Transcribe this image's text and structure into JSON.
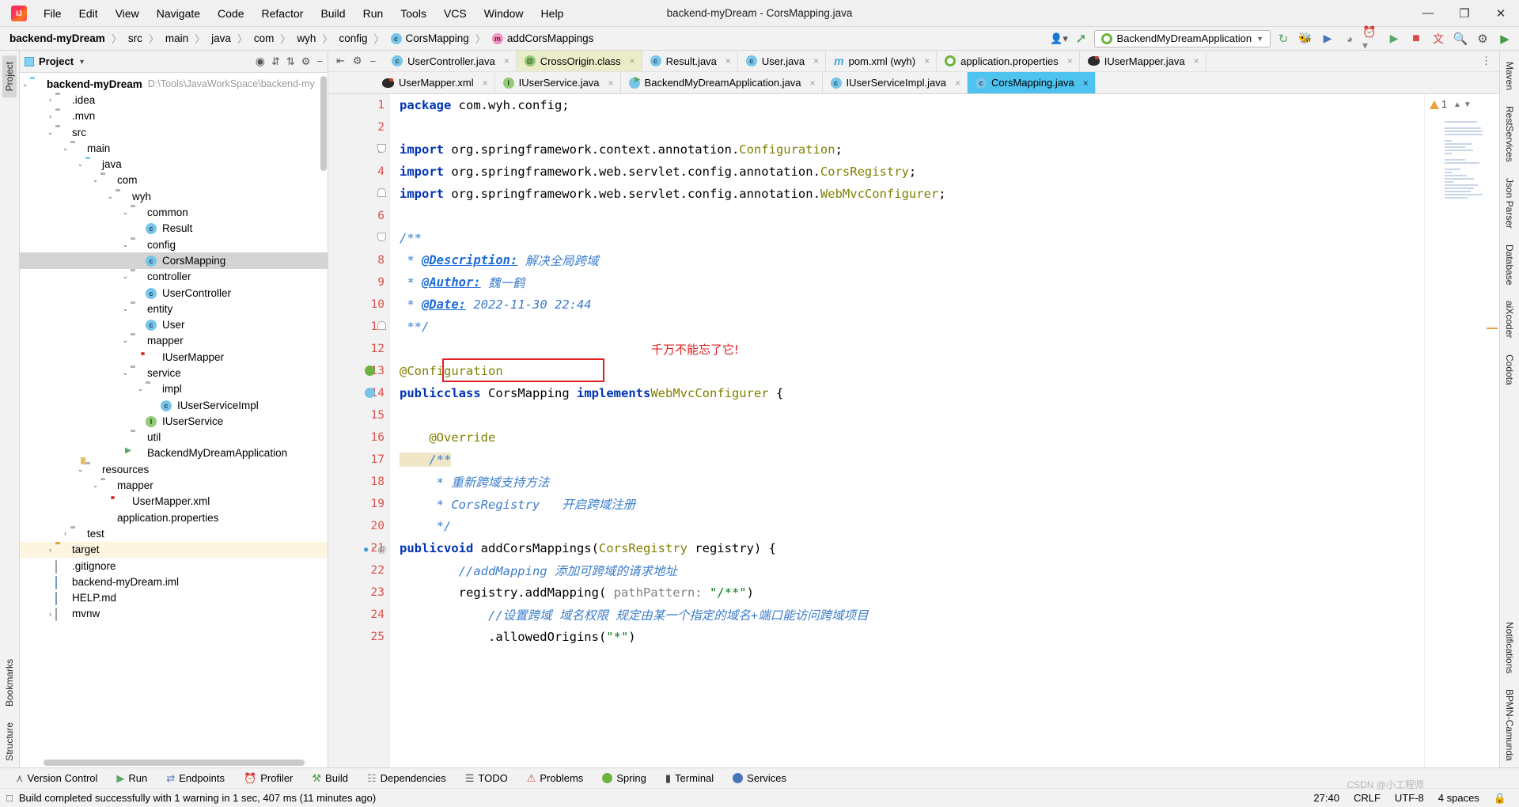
{
  "window": {
    "title": "backend-myDream - CorsMapping.java",
    "minimize": "—",
    "maximize": "❐",
    "close": "✕"
  },
  "menu": [
    "File",
    "Edit",
    "View",
    "Navigate",
    "Code",
    "Refactor",
    "Build",
    "Run",
    "Tools",
    "VCS",
    "Window",
    "Help"
  ],
  "breadcrumb": {
    "items": [
      "backend-myDream",
      "src",
      "main",
      "java",
      "com",
      "wyh",
      "config",
      "CorsMapping",
      "addCorsMappings"
    ],
    "separator": "〉"
  },
  "toolbar": {
    "run_config": "BackendMyDreamApplication",
    "chevron": "▼"
  },
  "project_panel": {
    "title": "Project",
    "dropdown": "▼",
    "root_label": "backend-myDream",
    "root_path": "D:\\Tools\\JavaWorkSpace\\backend-my",
    "tree": [
      {
        "label": ".idea",
        "depth": 1,
        "arrow": "›",
        "icon": "folder-gray"
      },
      {
        "label": ".mvn",
        "depth": 1,
        "arrow": "›",
        "icon": "folder-gray"
      },
      {
        "label": "src",
        "depth": 1,
        "arrow": "⌄",
        "icon": "folder-gray"
      },
      {
        "label": "main",
        "depth": 2,
        "arrow": "⌄",
        "icon": "folder-gray"
      },
      {
        "label": "java",
        "depth": 3,
        "arrow": "⌄",
        "icon": "folder-blue"
      },
      {
        "label": "com",
        "depth": 4,
        "arrow": "⌄",
        "icon": "folder-pkg"
      },
      {
        "label": "wyh",
        "depth": 5,
        "arrow": "⌄",
        "icon": "folder-pkg"
      },
      {
        "label": "common",
        "depth": 6,
        "arrow": "⌄",
        "icon": "folder-pkg"
      },
      {
        "label": "Result",
        "depth": 7,
        "arrow": "",
        "icon": "class"
      },
      {
        "label": "config",
        "depth": 6,
        "arrow": "⌄",
        "icon": "folder-pkg"
      },
      {
        "label": "CorsMapping",
        "depth": 7,
        "arrow": "",
        "icon": "class",
        "selected": true
      },
      {
        "label": "controller",
        "depth": 6,
        "arrow": "⌄",
        "icon": "folder-pkg"
      },
      {
        "label": "UserController",
        "depth": 7,
        "arrow": "",
        "icon": "class"
      },
      {
        "label": "entity",
        "depth": 6,
        "arrow": "⌄",
        "icon": "folder-pkg"
      },
      {
        "label": "User",
        "depth": 7,
        "arrow": "",
        "icon": "class"
      },
      {
        "label": "mapper",
        "depth": 6,
        "arrow": "⌄",
        "icon": "folder-pkg"
      },
      {
        "label": "IUserMapper",
        "depth": 7,
        "arrow": "",
        "icon": "mybatis"
      },
      {
        "label": "service",
        "depth": 6,
        "arrow": "⌄",
        "icon": "folder-pkg"
      },
      {
        "label": "impl",
        "depth": 7,
        "arrow": "⌄",
        "icon": "folder-pkg"
      },
      {
        "label": "IUserServiceImpl",
        "depth": 8,
        "arrow": "",
        "icon": "class"
      },
      {
        "label": "IUserService",
        "depth": 7,
        "arrow": "",
        "icon": "interface"
      },
      {
        "label": "util",
        "depth": 6,
        "arrow": "",
        "icon": "folder-pkg"
      },
      {
        "label": "BackendMyDreamApplication",
        "depth": 6,
        "arrow": "",
        "icon": "springapp"
      },
      {
        "label": "resources",
        "depth": 3,
        "arrow": "⌄",
        "icon": "resources"
      },
      {
        "label": "mapper",
        "depth": 4,
        "arrow": "⌄",
        "icon": "folder-gray"
      },
      {
        "label": "UserMapper.xml",
        "depth": 5,
        "arrow": "",
        "icon": "mybatis"
      },
      {
        "label": "application.properties",
        "depth": 4,
        "arrow": "",
        "icon": "properties"
      },
      {
        "label": "test",
        "depth": 2,
        "arrow": "›",
        "icon": "folder-gray"
      },
      {
        "label": "target",
        "depth": 1,
        "arrow": "›",
        "icon": "folder-orange",
        "highlight": true
      },
      {
        "label": ".gitignore",
        "depth": 1,
        "arrow": "",
        "icon": "file"
      },
      {
        "label": "backend-myDream.iml",
        "depth": 1,
        "arrow": "",
        "icon": "file-iml"
      },
      {
        "label": "HELP.md",
        "depth": 1,
        "arrow": "",
        "icon": "file-md"
      },
      {
        "label": "mvnw",
        "depth": 1,
        "arrow": "›",
        "icon": "file"
      }
    ]
  },
  "left_strip": [
    "Project",
    "Bookmarks",
    "Structure"
  ],
  "right_strip": [
    "Maven",
    "RestServices",
    "Json Parser",
    "Database",
    "aiXcoder",
    "Codota",
    "Notifications",
    "BPMN-Camunda"
  ],
  "editor_tabs": {
    "row1": [
      {
        "label": "UserController.java",
        "icon": "class",
        "close": "×"
      },
      {
        "label": "CrossOrigin.class",
        "icon": "annotation",
        "close": "×",
        "state": "yellow"
      },
      {
        "label": "Result.java",
        "icon": "class",
        "close": "×"
      },
      {
        "label": "User.java",
        "icon": "class",
        "close": "×"
      },
      {
        "label": "pom.xml (wyh)",
        "icon": "maven",
        "close": "×"
      },
      {
        "label": "application.properties",
        "icon": "properties",
        "close": "×"
      },
      {
        "label": "IUserMapper.java",
        "icon": "mybatis",
        "close": "×"
      }
    ],
    "row2": [
      {
        "label": "UserMapper.xml",
        "icon": "mybatis",
        "close": "×"
      },
      {
        "label": "IUserService.java",
        "icon": "interface",
        "close": "×"
      },
      {
        "label": "BackendMyDreamApplication.java",
        "icon": "springapp",
        "close": "×"
      },
      {
        "label": "IUserServiceImpl.java",
        "icon": "class",
        "close": "×"
      },
      {
        "label": "CorsMapping.java",
        "icon": "class",
        "close": "×",
        "state": "active"
      }
    ]
  },
  "code": {
    "inspection_count": "1",
    "lines": [
      {
        "n": "1",
        "text": "package com.wyh.config;"
      },
      {
        "n": "2",
        "text": ""
      },
      {
        "n": "3",
        "text": "import org.springframework.context.annotation.Configuration;"
      },
      {
        "n": "4",
        "text": "import org.springframework.web.servlet.config.annotation.CorsRegistry;"
      },
      {
        "n": "5",
        "text": "import org.springframework.web.servlet.config.annotation.WebMvcConfigurer;"
      },
      {
        "n": "6",
        "text": ""
      },
      {
        "n": "7",
        "text": "/**"
      },
      {
        "n": "8",
        "text": " * @Description: 解决全局跨域"
      },
      {
        "n": "9",
        "text": " * @Author: 魏一鹤"
      },
      {
        "n": "10",
        "text": " * @Date: 2022-11-30 22:44"
      },
      {
        "n": "11",
        "text": " **/"
      },
      {
        "n": "12",
        "text": ""
      },
      {
        "n": "13",
        "text": "@Configuration"
      },
      {
        "n": "14",
        "text": "public class CorsMapping implements WebMvcConfigurer {"
      },
      {
        "n": "15",
        "text": ""
      },
      {
        "n": "16",
        "text": "    @Override"
      },
      {
        "n": "17",
        "text": "    /**"
      },
      {
        "n": "18",
        "text": "     * 重新跨域支持方法"
      },
      {
        "n": "19",
        "text": "     * CorsRegistry   开启跨域注册"
      },
      {
        "n": "20",
        "text": "     */"
      },
      {
        "n": "21",
        "text": "    public void addCorsMappings(CorsRegistry registry) {"
      },
      {
        "n": "22",
        "text": "        //addMapping 添加可跨域的请求地址"
      },
      {
        "n": "23",
        "text": "        registry.addMapping( pathPattern: \"/**\")"
      },
      {
        "n": "24",
        "text": "            //设置跨域 域名权限 规定由某一个指定的域名+端口能访问跨域项目"
      },
      {
        "n": "25",
        "text": "            .allowedOrigins(\"*\")"
      }
    ],
    "annotation_note": "千万不能忘了它!"
  },
  "bottom_bar": [
    {
      "label": "Version Control",
      "icon": "branch"
    },
    {
      "label": "Run",
      "icon": "run"
    },
    {
      "label": "Endpoints",
      "icon": "endpoints"
    },
    {
      "label": "Profiler",
      "icon": "profiler"
    },
    {
      "label": "Build",
      "icon": "build"
    },
    {
      "label": "Dependencies",
      "icon": "dependencies"
    },
    {
      "label": "TODO",
      "icon": "todo"
    },
    {
      "label": "Problems",
      "icon": "problems"
    },
    {
      "label": "Spring",
      "icon": "spring"
    },
    {
      "label": "Terminal",
      "icon": "terminal"
    },
    {
      "label": "Services",
      "icon": "services"
    }
  ],
  "status_bar": {
    "message": "Build completed successfully with 1 warning in 1 sec, 407 ms (11 minutes ago)",
    "caret": "27:40",
    "line_sep": "CRLF",
    "encoding": "UTF-8",
    "indent": "4 spaces",
    "watermark": "CSDN @小工程师"
  }
}
